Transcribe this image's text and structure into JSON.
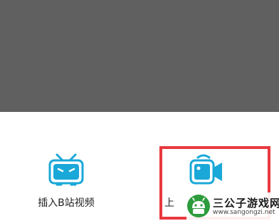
{
  "sheet": {
    "options": [
      {
        "label": "插入B站视频",
        "icon": "bilibili-tv-icon"
      },
      {
        "label": "上",
        "icon": "video-camera-icon"
      }
    ]
  },
  "watermark": {
    "title": "三公子游戏网",
    "url": "www.sangongzi.net"
  },
  "colors": {
    "overlay": "#606060",
    "icon_accent": "#1aa8d8",
    "highlight": "#e8393f",
    "watermark_green": "#2d9c3c"
  }
}
